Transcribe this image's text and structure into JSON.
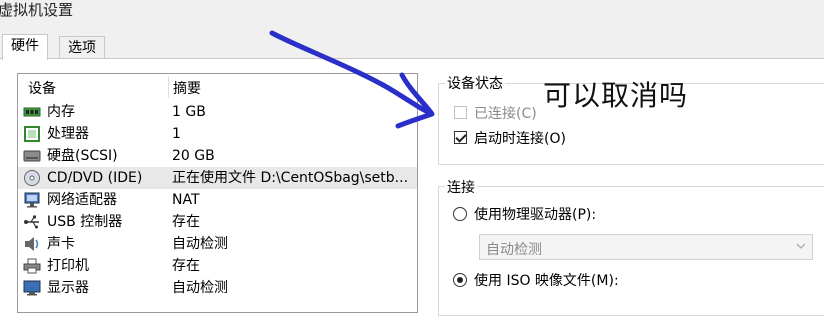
{
  "window": {
    "title": "虚拟机设置"
  },
  "tabs": [
    {
      "label": "硬件",
      "active": true
    },
    {
      "label": "选项",
      "active": false
    }
  ],
  "device_list": {
    "headers": {
      "device": "设备",
      "summary": "摘要"
    },
    "rows": [
      {
        "icon": "memory-icon",
        "name": "内存",
        "summary": "1 GB"
      },
      {
        "icon": "cpu-icon",
        "name": "处理器",
        "summary": "1"
      },
      {
        "icon": "harddisk-icon",
        "name": "硬盘(SCSI)",
        "summary": "20 GB"
      },
      {
        "icon": "cd-dvd-icon",
        "name": "CD/DVD (IDE)",
        "summary": "正在使用文件 D:\\CentOSbag\\setb...",
        "selected": true
      },
      {
        "icon": "network-adapter-icon",
        "name": "网络适配器",
        "summary": "NAT"
      },
      {
        "icon": "usb-icon",
        "name": "USB 控制器",
        "summary": "存在"
      },
      {
        "icon": "sound-icon",
        "name": "声卡",
        "summary": "自动检测"
      },
      {
        "icon": "printer-icon",
        "name": "打印机",
        "summary": "存在"
      },
      {
        "icon": "display-icon",
        "name": "显示器",
        "summary": "自动检测"
      }
    ]
  },
  "device_status": {
    "title": "设备状态",
    "connected": {
      "label": "已连接(C)",
      "checked": false,
      "disabled": true
    },
    "connect_at_power_on": {
      "label": "启动时连接(O)",
      "checked": true
    }
  },
  "connection": {
    "title": "连接",
    "physical_drive": {
      "label": "使用物理驱动器(P):",
      "selected": false
    },
    "drive_select": {
      "value": "自动检测",
      "disabled": true
    },
    "iso_image": {
      "label": "使用 ISO 映像文件(M):",
      "selected": true
    }
  },
  "annotation": {
    "text": "可以取消吗",
    "color": "#2b2fc9"
  }
}
